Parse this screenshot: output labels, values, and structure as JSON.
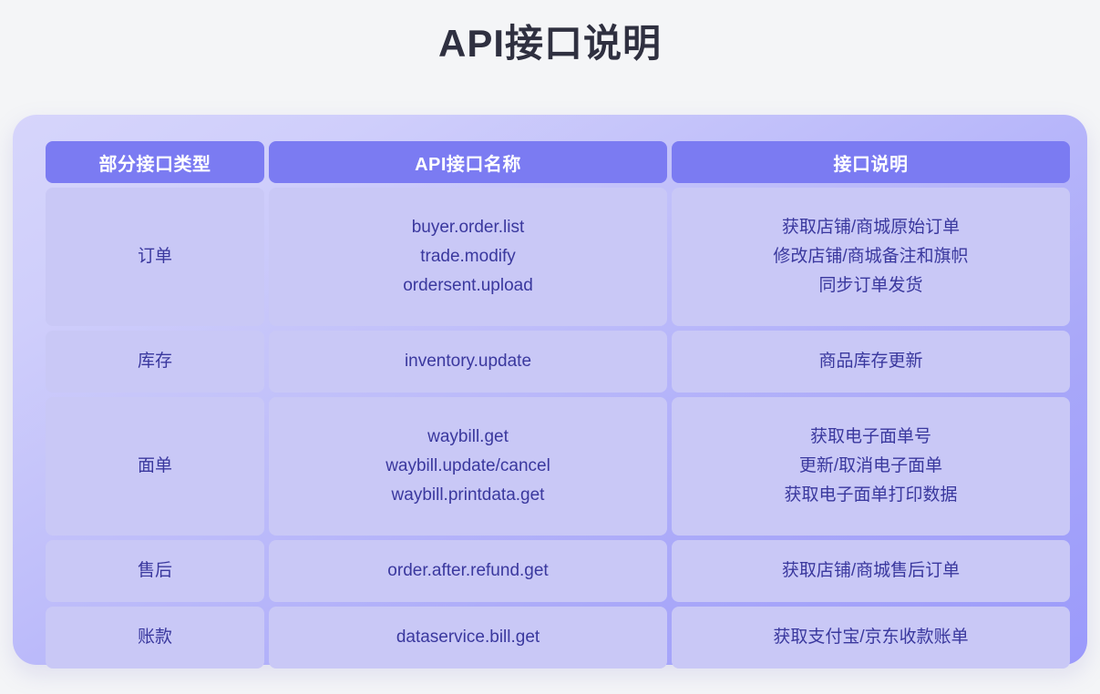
{
  "page": {
    "title": "API接口说明",
    "background_color": "#f4f5f7",
    "title_color": "#2f3040"
  },
  "card": {
    "accent_color": "#7b7bf2",
    "cell_color": "#c9c8f6",
    "cell_text_color": "#3a389e"
  },
  "table": {
    "headers": {
      "type": "部分接口类型",
      "name": "API接口名称",
      "desc": "接口说明"
    },
    "rows": [
      {
        "type": "订单",
        "names": [
          "buyer.order.list",
          "trade.modify",
          "ordersent.upload"
        ],
        "descs": [
          "获取店铺/商城原始订单",
          "修改店铺/商城备注和旗帜",
          "同步订单发货"
        ]
      },
      {
        "type": "库存",
        "names": [
          "inventory.update"
        ],
        "descs": [
          "商品库存更新"
        ]
      },
      {
        "type": "面单",
        "names": [
          "waybill.get",
          "waybill.update/cancel",
          "waybill.printdata.get"
        ],
        "descs": [
          "获取电子面单号",
          "更新/取消电子面单",
          "获取电子面单打印数据"
        ]
      },
      {
        "type": "售后",
        "names": [
          "order.after.refund.get"
        ],
        "descs": [
          "获取店铺/商城售后订单"
        ]
      },
      {
        "type": "账款",
        "names": [
          "dataservice.bill.get"
        ],
        "descs": [
          "获取支付宝/京东收款账单"
        ]
      }
    ]
  }
}
